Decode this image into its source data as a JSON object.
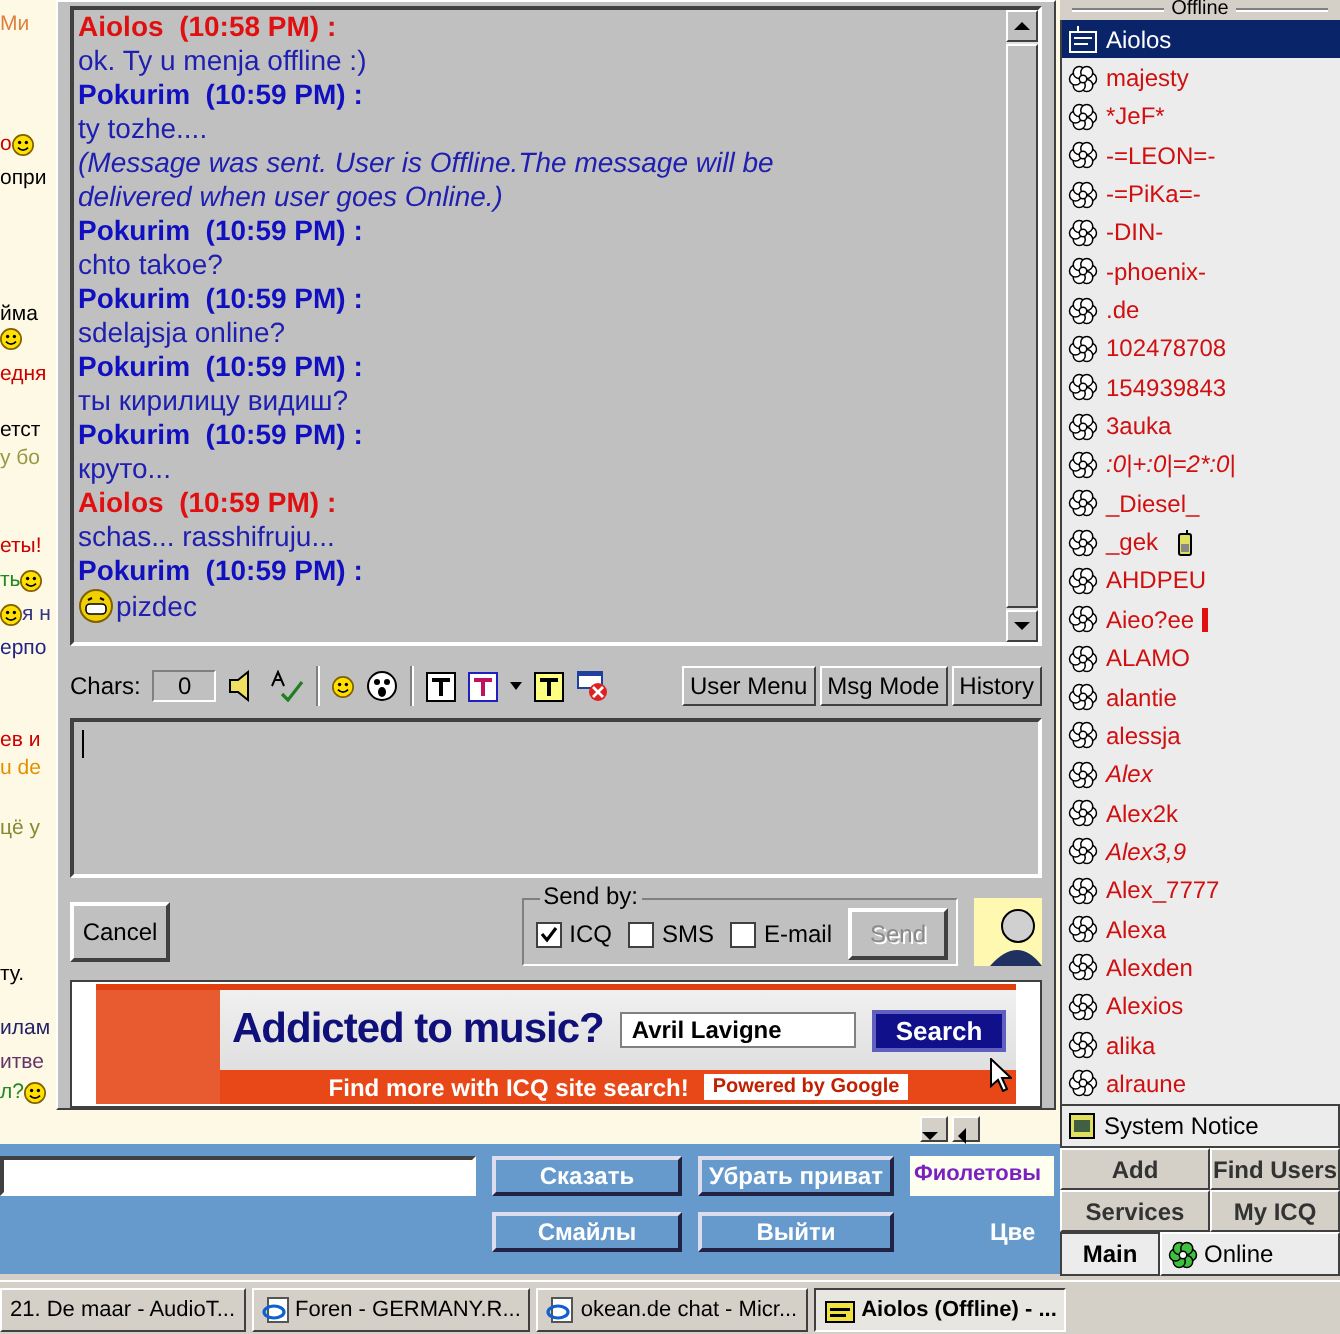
{
  "chat_page": {
    "fragments": [
      {
        "parts": [
          {
            "kind": "text",
            "text": "Ми",
            "color": "#e08040"
          }
        ]
      },
      {
        "parts": [
          {
            "kind": "text",
            "text": "о",
            "color": "#cc0000"
          },
          {
            "kind": "smiley"
          }
        ]
      },
      {
        "parts": [
          {
            "kind": "text",
            "text": "опри",
            "color": "#000000"
          }
        ]
      },
      {
        "parts": [
          {
            "kind": "text",
            "text": "йма",
            "color": "#000000"
          }
        ]
      },
      {
        "parts": [
          {
            "kind": "smiley"
          }
        ]
      },
      {
        "parts": [
          {
            "kind": "text",
            "text": "едня",
            "color": "#cc0000"
          }
        ]
      },
      {
        "parts": [
          {
            "kind": "text",
            "text": "етст",
            "color": "#000000"
          }
        ]
      },
      {
        "parts": [
          {
            "kind": "text",
            "text": "у бо",
            "color": "#999944"
          }
        ]
      },
      {
        "parts": [
          {
            "kind": "text",
            "text": "еты!",
            "color": "#cc0000"
          }
        ]
      },
      {
        "parts": [
          {
            "kind": "text",
            "text": "ть",
            "color": "#228822"
          },
          {
            "kind": "smiley"
          }
        ]
      },
      {
        "parts": [
          {
            "kind": "smiley"
          },
          {
            "kind": "text",
            "text": "я н",
            "color": "#333388"
          }
        ]
      },
      {
        "parts": [
          {
            "kind": "text",
            "text": "ерпо",
            "color": "#222288"
          }
        ]
      },
      {
        "parts": [
          {
            "kind": "text",
            "text": "ев и",
            "color": "#cc0000"
          }
        ]
      },
      {
        "parts": [
          {
            "kind": "text",
            "text": "u de",
            "color": "#e09000"
          }
        ]
      },
      {
        "parts": [
          {
            "kind": "text",
            "text": "цё у",
            "color": "#888833"
          }
        ]
      },
      {
        "parts": [
          {
            "kind": "text",
            "text": "ту.",
            "color": "#000000"
          }
        ]
      },
      {
        "parts": [
          {
            "kind": "text",
            "text": "илам",
            "color": "#222266"
          }
        ]
      },
      {
        "parts": [
          {
            "kind": "text",
            "text": "итве",
            "color": "#663366"
          }
        ]
      },
      {
        "parts": [
          {
            "kind": "text",
            "text": "л?",
            "color": "#228822"
          },
          {
            "kind": "smiley"
          }
        ]
      }
    ],
    "say_button": "Сказать",
    "private_button": "Убрать приват",
    "color_select": "Фиолетовы",
    "smileys_button": "Смайлы",
    "exit_button": "Выйти",
    "color_label": "Цве"
  },
  "message_window": {
    "messages": [
      {
        "kind": "header",
        "name": "Aiolos",
        "stamp": "(10:58 PM) :",
        "color": "#e01010"
      },
      {
        "kind": "text",
        "text": "ok. Ty u menja offline :)"
      },
      {
        "kind": "header",
        "name": "Pokurim",
        "stamp": "(10:59 PM) :",
        "color": "#1010c0"
      },
      {
        "kind": "text",
        "text": "ty tozhe...."
      },
      {
        "kind": "notice",
        "text": "(Message was sent. User is Offline.The message will be delivered when user goes Online.)"
      },
      {
        "kind": "header",
        "name": "Pokurim",
        "stamp": "(10:59 PM) :",
        "color": "#1010c0"
      },
      {
        "kind": "text",
        "text": "chto takoe?"
      },
      {
        "kind": "header",
        "name": "Pokurim",
        "stamp": "(10:59 PM) :",
        "color": "#1010c0"
      },
      {
        "kind": "text",
        "text": "sdelajsja online?"
      },
      {
        "kind": "header",
        "name": "Pokurim",
        "stamp": "(10:59 PM) :",
        "color": "#1010c0"
      },
      {
        "kind": "text",
        "text": "ты кирилицу видиш?"
      },
      {
        "kind": "header",
        "name": "Pokurim",
        "stamp": "(10:59 PM) :",
        "color": "#1010c0"
      },
      {
        "kind": "text",
        "text": "круто..."
      },
      {
        "kind": "header",
        "name": "Aiolos",
        "stamp": "(10:59 PM) :",
        "color": "#e01010"
      },
      {
        "kind": "text",
        "text": "schas... rasshifruju..."
      },
      {
        "kind": "header",
        "name": "Pokurim",
        "stamp": "(10:59 PM) :",
        "color": "#1010c0"
      },
      {
        "kind": "emoticon",
        "text": "pizdec"
      }
    ],
    "chars_label": "Chars:",
    "chars_count": "0",
    "toolbar_buttons": [
      "User Menu",
      "Msg Mode",
      "History"
    ],
    "cancel": "Cancel",
    "send_by": {
      "legend": "Send by:",
      "options": [
        {
          "label": "ICQ",
          "checked": true
        },
        {
          "label": "SMS",
          "checked": false
        },
        {
          "label": "E-mail",
          "checked": false
        }
      ]
    },
    "send": {
      "label": "Send",
      "disabled": true
    }
  },
  "banner": {
    "headline": "Addicted to music?",
    "search_value": "Avril Lavigne",
    "search_button": "Search",
    "tagline": "Find more with ICQ site search!",
    "powered": "Powered by Google"
  },
  "contact_list": {
    "group": "Offline",
    "contacts": [
      {
        "name": "Aiolos",
        "selected": true,
        "italic": false,
        "kind": "plain"
      },
      {
        "name": "majesty",
        "selected": false,
        "italic": false,
        "kind": "plain"
      },
      {
        "name": "*JeF*",
        "selected": false,
        "italic": false,
        "kind": "plain"
      },
      {
        "name": "-=LEON=-",
        "selected": false,
        "italic": false,
        "kind": "plain"
      },
      {
        "name": "-=PiKa=-",
        "selected": false,
        "italic": false,
        "kind": "plain"
      },
      {
        "name": "-DIN-",
        "selected": false,
        "italic": false,
        "kind": "plain"
      },
      {
        "name": "-phoenix-",
        "selected": false,
        "italic": false,
        "kind": "plain"
      },
      {
        "name": ".de",
        "selected": false,
        "italic": false,
        "kind": "plain"
      },
      {
        "name": "102478708",
        "selected": false,
        "italic": false,
        "kind": "plain"
      },
      {
        "name": "154939843",
        "selected": false,
        "italic": false,
        "kind": "plain"
      },
      {
        "name": "3auka",
        "selected": false,
        "italic": false,
        "kind": "plain"
      },
      {
        "name": ":0|+:0|=2*:0|",
        "selected": false,
        "italic": true,
        "kind": "plain"
      },
      {
        "name": "_Diesel_",
        "selected": false,
        "italic": false,
        "kind": "plain"
      },
      {
        "name": "_gek",
        "selected": false,
        "italic": false,
        "kind": "phone"
      },
      {
        "name": "AHDPEU",
        "selected": false,
        "italic": false,
        "kind": "plain"
      },
      {
        "name": "Aieo?ee",
        "selected": false,
        "italic": false,
        "kind": "bar"
      },
      {
        "name": "ALAMO",
        "selected": false,
        "italic": false,
        "kind": "plain"
      },
      {
        "name": "alantie",
        "selected": false,
        "italic": false,
        "kind": "plain"
      },
      {
        "name": "alessja",
        "selected": false,
        "italic": false,
        "kind": "plain"
      },
      {
        "name": "Alex",
        "selected": false,
        "italic": true,
        "kind": "plain"
      },
      {
        "name": "Alex2k",
        "selected": false,
        "italic": false,
        "kind": "plain"
      },
      {
        "name": "Alex3,9",
        "selected": false,
        "italic": true,
        "kind": "plain"
      },
      {
        "name": "Alex_7777",
        "selected": false,
        "italic": false,
        "kind": "plain"
      },
      {
        "name": "Alexa",
        "selected": false,
        "italic": false,
        "kind": "plain"
      },
      {
        "name": "Alexden",
        "selected": false,
        "italic": false,
        "kind": "plain"
      },
      {
        "name": "Alexios",
        "selected": false,
        "italic": false,
        "kind": "plain"
      },
      {
        "name": "alika",
        "selected": false,
        "italic": false,
        "kind": "plain"
      },
      {
        "name": "alraune",
        "selected": false,
        "italic": false,
        "kind": "plain"
      }
    ],
    "system_notice": "System Notice",
    "buttons": [
      "Add",
      "Find Users",
      "Services",
      "My ICQ"
    ],
    "main_tab": "Main",
    "status": "Online"
  },
  "taskbar": [
    {
      "label": "21. De maar - AudioT...",
      "selected": false,
      "kind": "media"
    },
    {
      "label": "Foren - GERMANY.R...",
      "selected": false,
      "kind": "browser"
    },
    {
      "label": "okean.de chat - Micr...",
      "selected": false,
      "kind": "browser"
    },
    {
      "label": "Aiolos (Offline) - ...",
      "selected": true,
      "kind": "icq"
    }
  ]
}
